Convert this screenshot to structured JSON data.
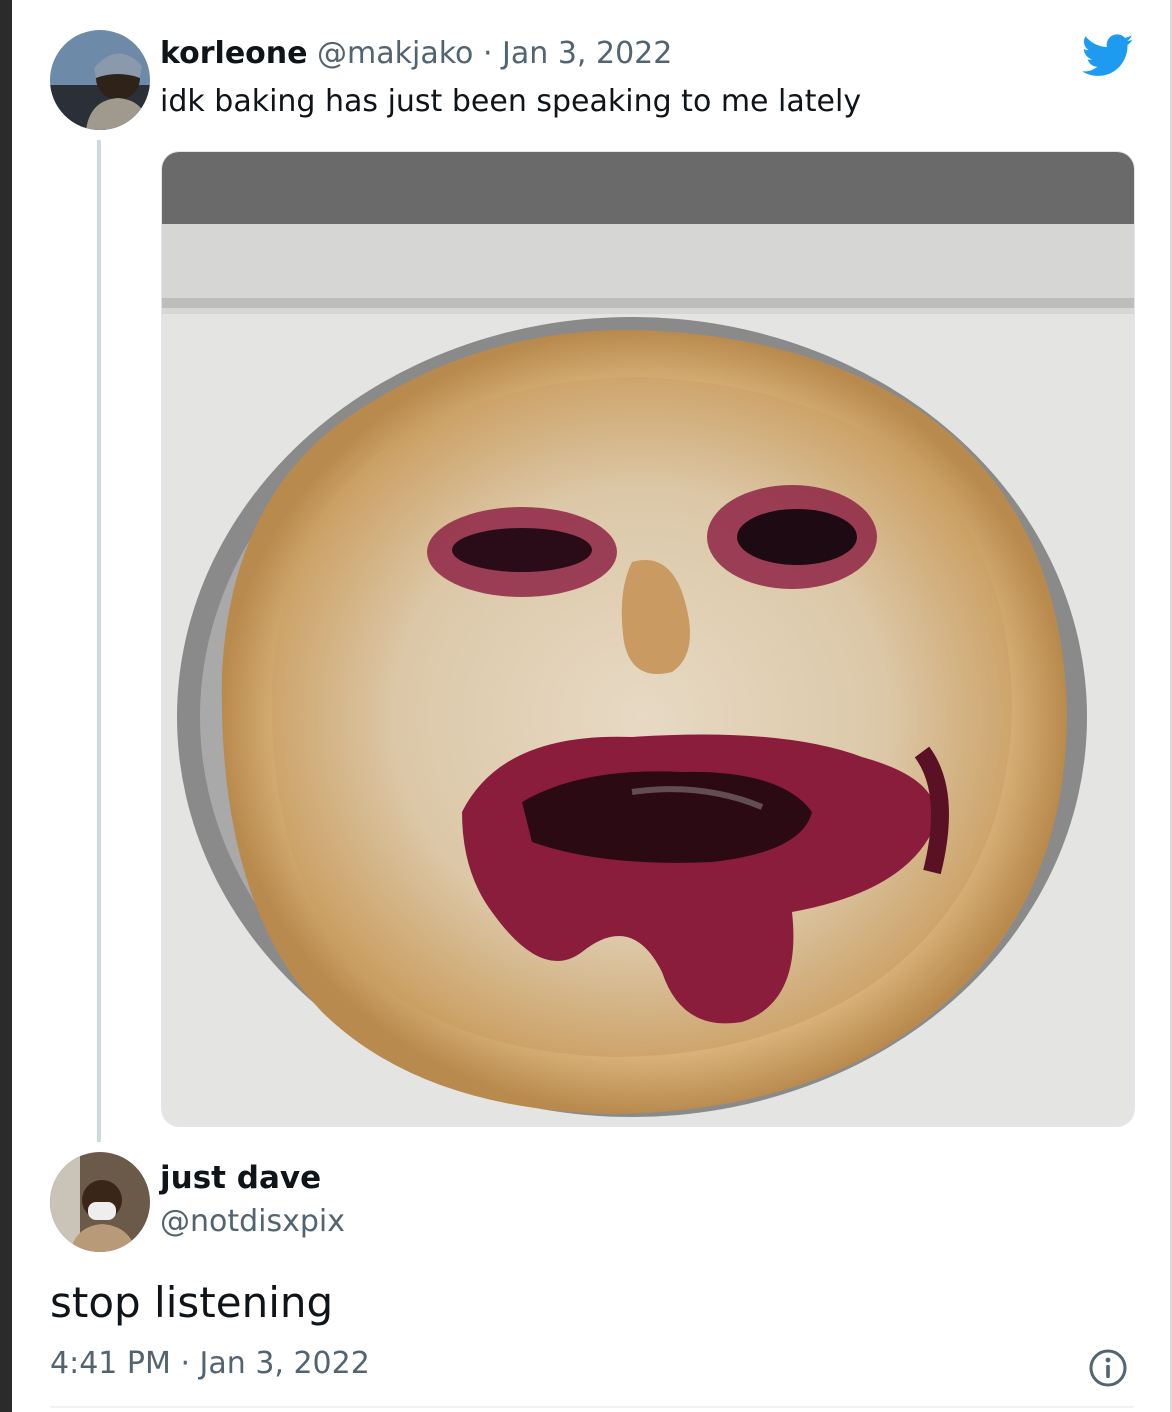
{
  "tweet": {
    "author_name": "korleone",
    "author_handle": "@makjako",
    "separator": "·",
    "date": "Jan 3, 2022",
    "text": "idk baking has just been speaking to me lately",
    "image_icon": "pie-photo"
  },
  "reply": {
    "author_name": "just dave",
    "author_handle": "@notdisxpix",
    "text": "stop listening",
    "time": "4:41 PM",
    "separator": "·",
    "date": "Jan 3, 2022"
  },
  "icons": {
    "brand": "twitter-bird-icon",
    "info": "info-icon"
  },
  "colors": {
    "twitter_blue": "#1d9bf0",
    "text_primary": "#0f1419",
    "text_secondary": "#536471"
  }
}
